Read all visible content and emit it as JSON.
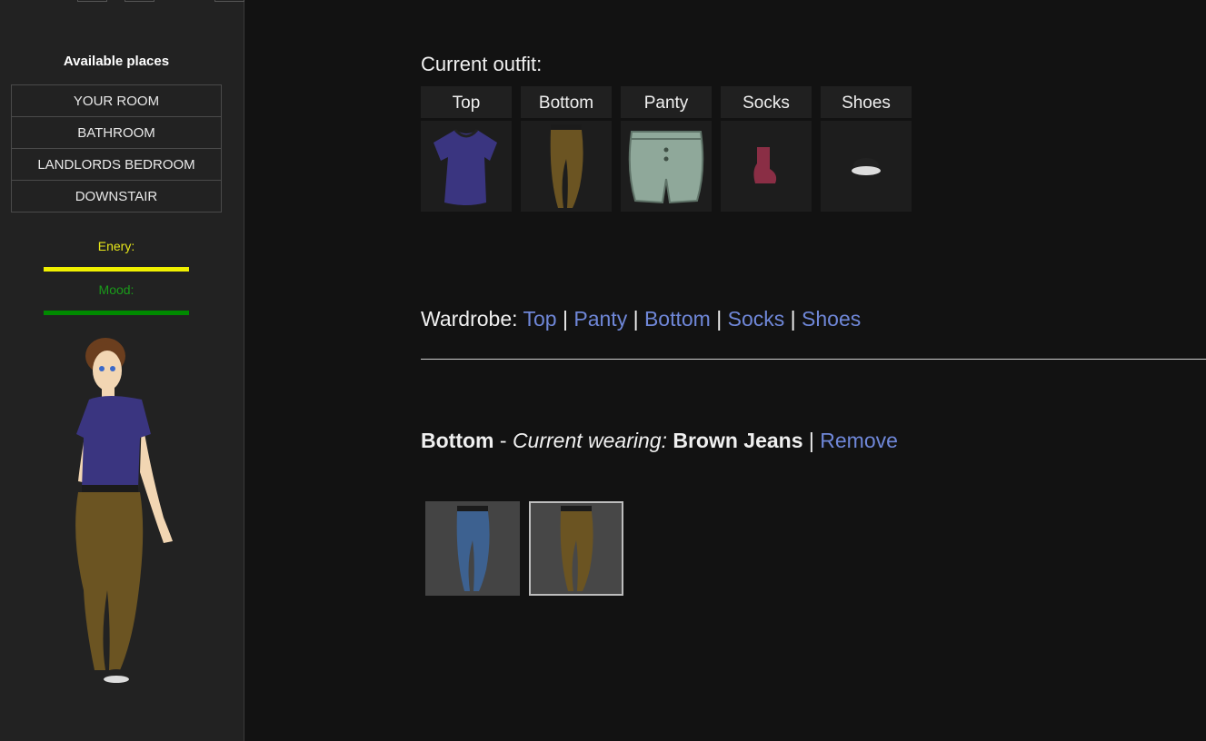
{
  "sidebar": {
    "places_title": "Available places",
    "places": [
      "YOUR ROOM",
      "BATHROOM",
      "LANDLORDS BEDROOM",
      "DOWNSTAIR"
    ],
    "energy_label": "Enery:",
    "energy_value": 1.0,
    "energy_color": "#f0f000",
    "mood_label": "Mood:",
    "mood_value": 1.0,
    "mood_color": "#008a00"
  },
  "outfit": {
    "title": "Current outfit:",
    "slots": [
      {
        "label": "Top",
        "icon": "purple-tshirt-icon"
      },
      {
        "label": "Bottom",
        "icon": "brown-jeans-icon"
      },
      {
        "label": "Panty",
        "icon": "green-boxers-icon"
      },
      {
        "label": "Socks",
        "icon": "red-socks-icon"
      },
      {
        "label": "Shoes",
        "icon": "sneakers-icon"
      }
    ]
  },
  "wardrobe": {
    "label": "Wardrobe:",
    "links": [
      "Top",
      "Panty",
      "Bottom",
      "Socks",
      "Shoes"
    ]
  },
  "current": {
    "category": "Bottom",
    "dash": "-",
    "wearing_label": "Current wearing:",
    "item": "Brown Jeans",
    "remove": "Remove"
  },
  "options": [
    {
      "icon": "blue-jeans-icon",
      "selected": false
    },
    {
      "icon": "brown-jeans-icon",
      "selected": true
    }
  ],
  "colors": {
    "link": "#6f87d8",
    "brown_jeans": "#6b5422",
    "blue_jeans": "#3d6190",
    "tshirt": "#3a3580"
  }
}
